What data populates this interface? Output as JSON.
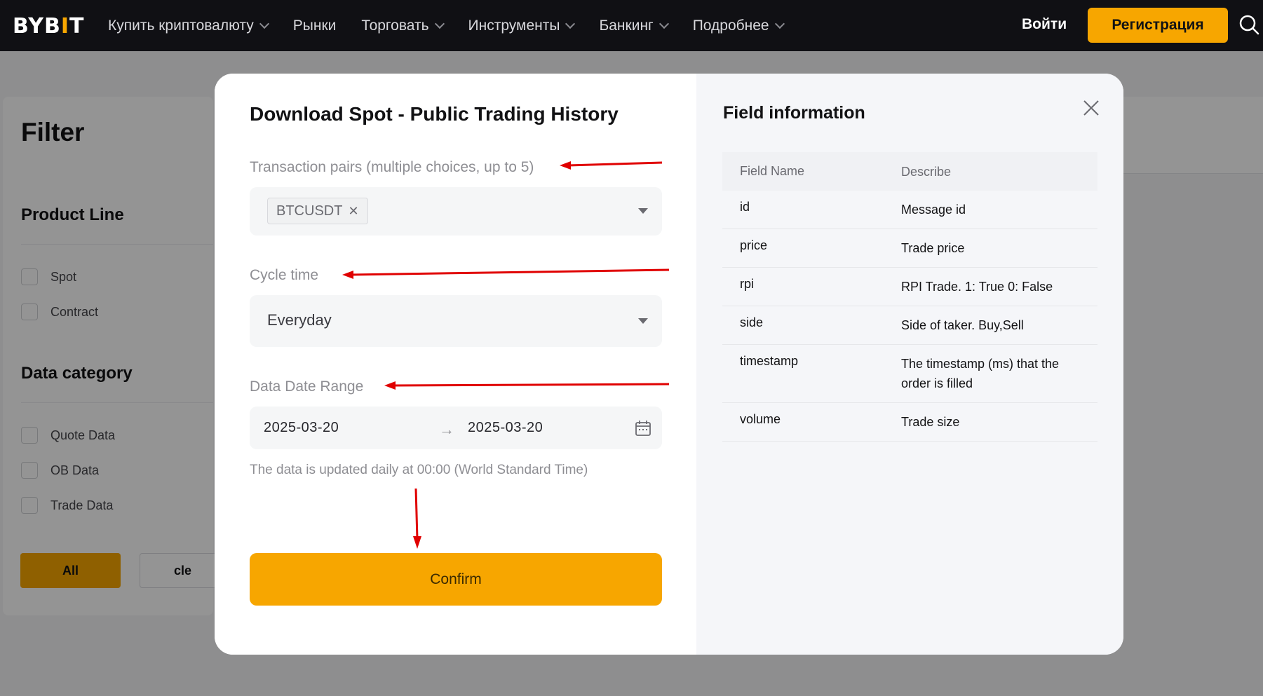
{
  "nav": {
    "logo_main": "BYB",
    "logo_bar": "I",
    "logo_end": "T",
    "items": [
      {
        "label": "Купить криптовалюту",
        "has_chevron": true
      },
      {
        "label": "Рынки",
        "has_chevron": false
      },
      {
        "label": "Торговать",
        "has_chevron": true
      },
      {
        "label": "Инструменты",
        "has_chevron": true
      },
      {
        "label": "Банкинг",
        "has_chevron": true
      },
      {
        "label": "Подробнее",
        "has_chevron": true
      }
    ],
    "login": "Войти",
    "register": "Регистрация"
  },
  "filter": {
    "title": "Filter",
    "product_line": {
      "title": "Product Line",
      "options": [
        "Spot",
        "Contract"
      ]
    },
    "data_category": {
      "title": "Data category",
      "options": [
        "Quote Data",
        "OB Data",
        "Trade Data"
      ]
    },
    "all_button": "All",
    "clear_button": "cle"
  },
  "modal": {
    "title": "Download Spot - Public Trading History",
    "pairs_label": "Transaction pairs (multiple choices, up to 5)",
    "pairs_selected": [
      "BTCUSDT"
    ],
    "cycle_label": "Cycle time",
    "cycle_value": "Everyday",
    "date_label": "Data Date Range",
    "date_start": "2025-03-20",
    "date_arrow": "→",
    "date_end": "2025-03-20",
    "note": "The data is updated daily at 00:00 (World Standard Time)",
    "confirm": "Confirm"
  },
  "field_info": {
    "title": "Field information",
    "headers": [
      "Field Name",
      "Describe"
    ],
    "rows": [
      {
        "name": "id",
        "desc": "Message id"
      },
      {
        "name": "price",
        "desc": "Trade price"
      },
      {
        "name": "rpi",
        "desc": "RPI Trade. 1: True 0: False"
      },
      {
        "name": "side",
        "desc": "Side of taker. Buy,Sell"
      },
      {
        "name": "timestamp",
        "desc": "The timestamp (ms) that the order is filled"
      },
      {
        "name": "volume",
        "desc": "Trade size"
      }
    ]
  },
  "colors": {
    "accent": "#f7a600",
    "nav_bg": "#101014",
    "annotation_red": "#e00000"
  }
}
